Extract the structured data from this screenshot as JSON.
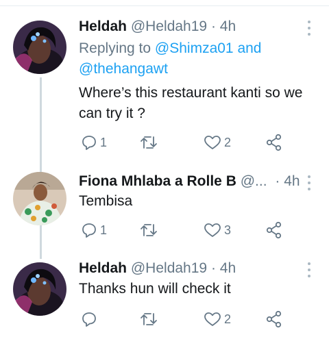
{
  "tweets": [
    {
      "name": "Heldah",
      "handle": "@Heldah19",
      "dot": "·",
      "time": "4h",
      "replying_prefix": "Replying to",
      "replying_to_1": "@Shimza01",
      "replying_and": "and",
      "replying_to_2": "@thehangawt",
      "text": "Where’s this restaurant kanti so we can try it ?",
      "reply_count": "1",
      "retweet_count": "",
      "like_count": "2"
    },
    {
      "name": "Fiona Mhlaba a Rolle B",
      "handle": "@...",
      "dot": "·",
      "time": "4h",
      "text": "Tembisa",
      "reply_count": "1",
      "retweet_count": "",
      "like_count": "3"
    },
    {
      "name": "Heldah",
      "handle": "@Heldah19",
      "dot": "·",
      "time": "4h",
      "text": "Thanks hun will check it",
      "reply_count": "",
      "retweet_count": "",
      "like_count": "2"
    }
  ],
  "icons": {
    "reply": "reply-icon",
    "retweet": "retweet-icon",
    "like": "heart-icon",
    "share": "share-icon",
    "more": "more-vertical-icon"
  },
  "colors": {
    "link": "#1da1f2",
    "muted": "#657786",
    "thread": "#cfd9de"
  }
}
